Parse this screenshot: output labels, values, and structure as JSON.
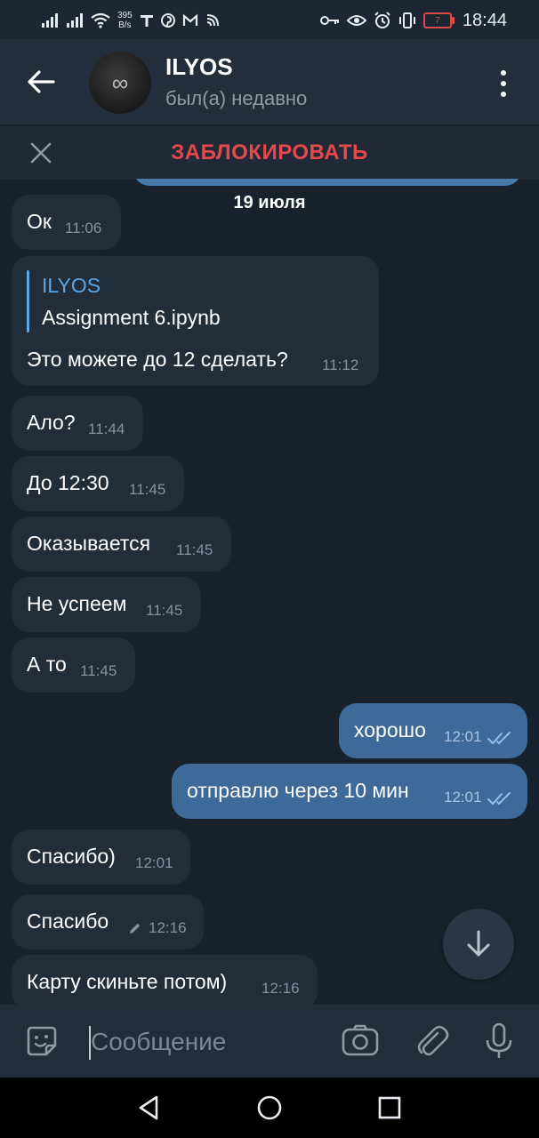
{
  "status_bar": {
    "net_speed_value": "395",
    "net_speed_unit": "B/s",
    "battery_level": "7",
    "time": "18:44"
  },
  "header": {
    "name": "ILYOS",
    "status": "был(а) недавно"
  },
  "block_bar": {
    "label": "ЗАБЛОКИРОВАТЬ"
  },
  "chat": {
    "date": "19 июля",
    "messages": [
      {
        "dir": "in",
        "text": "Ок",
        "time": "11:06"
      },
      {
        "dir": "in",
        "reply_to": "ILYOS",
        "reply_text": "Assignment 6.ipynb",
        "text": "Это можете до 12 сделать?",
        "time": "11:12"
      },
      {
        "dir": "in",
        "text": "Ало?",
        "time": "11:44"
      },
      {
        "dir": "in",
        "text": "До 12:30",
        "time": "11:45"
      },
      {
        "dir": "in",
        "text": "Оказывается",
        "time": "11:45"
      },
      {
        "dir": "in",
        "text": "Не успеем",
        "time": "11:45"
      },
      {
        "dir": "in",
        "text": "А то",
        "time": "11:45"
      },
      {
        "dir": "out",
        "text": "хорошо",
        "time": "12:01",
        "read": true
      },
      {
        "dir": "out",
        "text": "отправлю через 10 мин",
        "time": "12:01",
        "read": true
      },
      {
        "dir": "in",
        "text": "Спасибо)",
        "time": "12:01"
      },
      {
        "dir": "in",
        "text": "Спасибо",
        "time": "12:16",
        "edited": true
      },
      {
        "dir": "in",
        "text": "Карту скиньте потом)",
        "time": "12:16"
      }
    ]
  },
  "composer": {
    "placeholder": "Сообщение"
  },
  "colors": {
    "background": "#18222d",
    "header": "#232e3c",
    "incoming_bubble": "#222d3a",
    "outgoing_bubble": "#3d6a98",
    "block_red": "#e6484c",
    "accent_blue": "#5aa6e6"
  },
  "icons": {
    "header": [
      "back-arrow-icon",
      "more-vertical-icon"
    ],
    "block_bar": [
      "close-icon"
    ],
    "composer": [
      "sticker-icon",
      "camera-icon",
      "attach-icon",
      "microphone-icon"
    ],
    "chat": [
      "scroll-down-icon",
      "pencil-icon",
      "double-check-icon"
    ],
    "navigation": [
      "nav-back-icon",
      "nav-home-icon",
      "nav-recents-icon"
    ]
  }
}
